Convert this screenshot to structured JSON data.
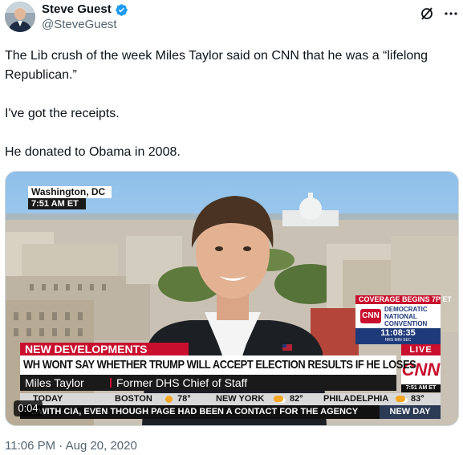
{
  "author": {
    "display_name": "Steve Guest",
    "handle": "@SteveGuest",
    "verified": true
  },
  "icons": {
    "more": "more-dots-icon",
    "grok": "slashed-circle-icon",
    "verified": "verified-badge-icon"
  },
  "tweet": {
    "lines": [
      "The Lib crush of the week Miles Taylor said on CNN that he was a “lifelong Republican.”",
      "I've got the receipts.",
      "He donated to Obama in 2008."
    ],
    "timestamp": "11:06 PM · Aug 20, 2020"
  },
  "video": {
    "location": "Washington, DC",
    "location_time": "7:51 AM ET",
    "coverage_banner": "COVERAGE BEGINS 7P ET",
    "convention_label": "DEMOCRATIC NATIONAL CONVENTION",
    "countdown": "11:08:35",
    "countdown_units": "HRS  MIN  SEC",
    "live": "LIVE",
    "network": "CNN",
    "corner_time": "7:51 AM ET",
    "breaking_label": "NEW DEVELOPMENTS",
    "headline": "WH WONT SAY WHETHER TRUMP WILL ACCEPT ELECTION RESULTS IF HE LOSES",
    "guest_name": "Miles Taylor",
    "guest_title": "Former DHS Chief of Staff",
    "weather_label": "TODAY",
    "weather": [
      {
        "city": "BOSTON",
        "temp": "78°"
      },
      {
        "city": "NEW YORK",
        "temp": "82°"
      },
      {
        "city": "PHILADELPHIA",
        "temp": "83°"
      }
    ],
    "ticker": "...WITH CIA, EVEN THOUGH PAGE HAD BEEN A CONTACT FOR THE AGENCY",
    "ticker_tag": "NEW DAY",
    "elapsed": "0:04"
  }
}
